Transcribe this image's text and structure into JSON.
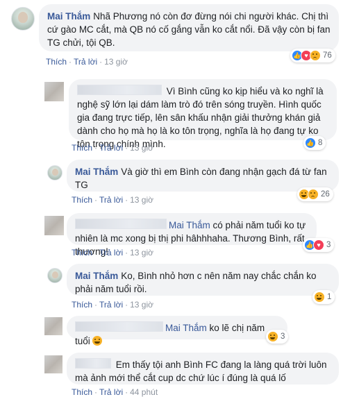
{
  "actions": {
    "like": "Thích",
    "reply": "Trả lời",
    "sep": "·"
  },
  "colors": {
    "link": "#385898",
    "bubble": "#f2f3f5",
    "meta": "#8d949e",
    "like": "#2d88ff",
    "love": "#f33e58",
    "haha": "#f7b125"
  },
  "comments": [
    {
      "author": "Mai Thắm",
      "text": "Nhã Phương nó còn đơ đừng nói chi người khác. Chị thì cứ gào MC cắt, mà QB nó cố gắng vẫn ko cắt nổi. Đã vậy còn bị fan TG chửi, tội QB.",
      "time": "13 giờ",
      "reactions": [
        "like",
        "love",
        "sad"
      ],
      "count": "76"
    },
    {
      "author": "",
      "text": "Vì Bình cũng ko kịp hiểu và ko nghĩ là nghệ sỹ lớn lại dám làm trò đó trên sóng truyền. Hình quốc gia đang trực tiếp, lên sân khấu nhận giải thưởng khán giả dành cho họ mà họ là ko tôn trọng, nghĩa là họ đang tự ko tôn trọng chính mình.",
      "time": "13 giờ",
      "reactions": [
        "like"
      ],
      "count": "8"
    },
    {
      "author": "Mai Thắm",
      "text": "Và giờ thì em Bình còn đang nhận gạch đá từ fan TG",
      "time": "13 giờ",
      "reactions": [
        "haha",
        "sad"
      ],
      "count": "26"
    },
    {
      "author": "",
      "mention": "Mai Thắm",
      "text": "có phải năm tuổi ko tự nhiên là mc xong bị thị phi hâhhhaha. Thương Bình, rất thương!",
      "time": "13 giờ",
      "reactions": [
        "like",
        "love"
      ],
      "count": "3"
    },
    {
      "author": "Mai Thắm",
      "text": "Ko, Bình nhỏ hơn c nên năm nay chắc chắn ko phải năm tuổi rồi.",
      "time": "13 giờ",
      "reactions": [
        "haha"
      ],
      "count": "1"
    },
    {
      "author": "",
      "mention": "Mai Thắm",
      "text": "ko lẽ chị năm tuổi",
      "emoji": "rofl-emoji",
      "time": "",
      "reactions": [
        "haha"
      ],
      "count": "3"
    },
    {
      "author": "",
      "text": "Em thấy tội anh Bình FC đang la làng quá trời luôn mà ảnh mới thể cắt cup dc chứ lúc í đúng là quá lố",
      "time": "44 phút",
      "reactions": [],
      "count": ""
    }
  ]
}
